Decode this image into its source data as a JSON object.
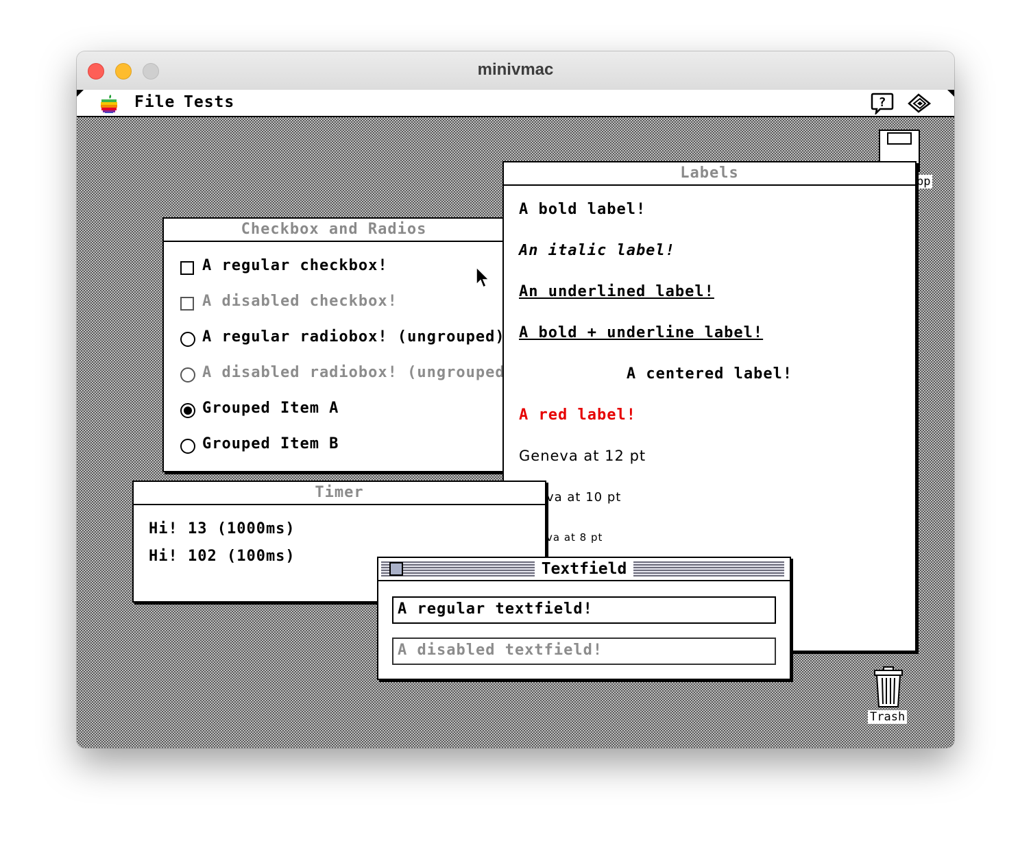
{
  "host": {
    "title": "minivmac"
  },
  "menubar": {
    "menus": [
      "File",
      "Tests"
    ]
  },
  "desktop": {
    "trash_label": "Trash",
    "disk_label_fragment": "pp"
  },
  "checkbox_window": {
    "title": "Checkbox and Radios",
    "regular_checkbox": "A regular checkbox!",
    "disabled_checkbox": "A disabled checkbox!",
    "regular_radio": "A regular radiobox! (ungrouped)",
    "disabled_radio": "A disabled radiobox! (ungrouped)",
    "grouped_a": "Grouped Item A",
    "grouped_b": "Grouped Item B"
  },
  "labels_window": {
    "title": "Labels",
    "bold": "A bold label!",
    "italic": "An italic label!",
    "underlined": "An underlined label!",
    "bold_underline": "A bold + underline label!",
    "centered": "A centered label!",
    "red": "A red label!",
    "geneva12": "Geneva at 12 pt",
    "geneva10_fragment": "va at 10 pt",
    "geneva8_fragment": "va at 8 pt",
    "red_color": "#e60000"
  },
  "timer_window": {
    "title": "Timer",
    "line1": "Hi! 13 (1000ms)",
    "line2": "Hi! 102 (100ms)"
  },
  "textfield_window": {
    "title": "Textfield",
    "regular": "A regular textfield!",
    "disabled": "A disabled textfield!"
  }
}
